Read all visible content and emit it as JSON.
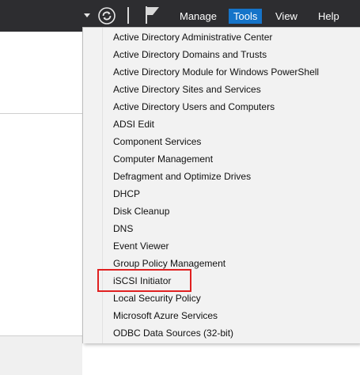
{
  "topbar": {
    "menu": {
      "manage": "Manage",
      "tools": "Tools",
      "view": "View",
      "help": "Help"
    },
    "icons": {
      "caret": "chevron-down-icon",
      "refresh": "refresh-icon",
      "flag": "notification-flag-icon"
    }
  },
  "tools_menu": {
    "items": [
      "Active Directory Administrative Center",
      "Active Directory Domains and Trusts",
      "Active Directory Module for Windows PowerShell",
      "Active Directory Sites and Services",
      "Active Directory Users and Computers",
      "ADSI Edit",
      "Component Services",
      "Computer Management",
      "Defragment and Optimize Drives",
      "DHCP",
      "Disk Cleanup",
      "DNS",
      "Event Viewer",
      "Group Policy Management",
      "iSCSI Initiator",
      "Local Security Policy",
      "Microsoft Azure Services",
      "ODBC Data Sources (32-bit)"
    ]
  },
  "colors": {
    "topbar_bg": "#2d2d30",
    "active_menu_bg": "#1574c9",
    "highlight_border": "#e02020"
  }
}
